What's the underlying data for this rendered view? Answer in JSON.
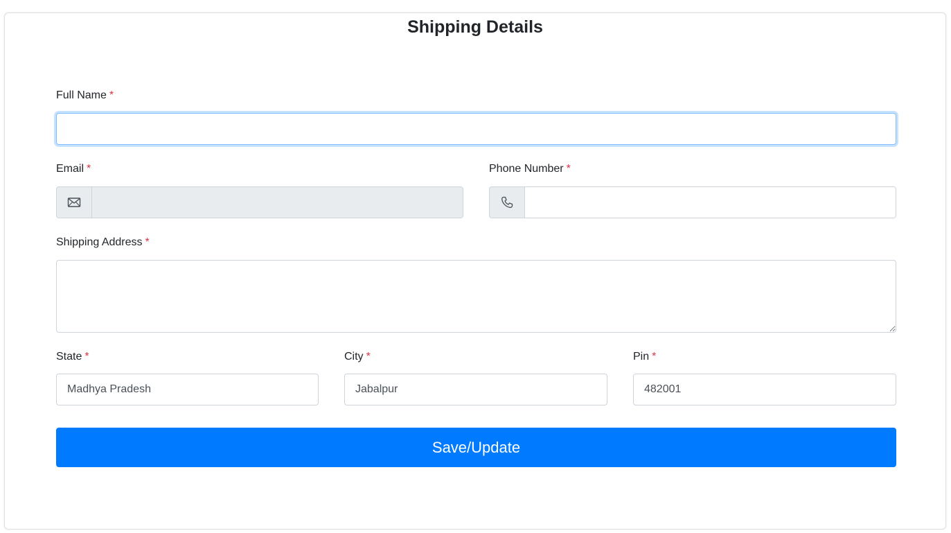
{
  "form": {
    "title": "Shipping Details",
    "required_mark": "*",
    "full_name": {
      "label": "Full Name",
      "value": "",
      "placeholder": ""
    },
    "email": {
      "label": "Email",
      "value": "",
      "icon": "envelope-icon"
    },
    "phone": {
      "label": "Phone Number",
      "value": "",
      "icon": "phone-icon"
    },
    "address": {
      "label": "Shipping Address",
      "value": ""
    },
    "state": {
      "label": "State",
      "value": "Madhya Pradesh"
    },
    "city": {
      "label": "City",
      "value": "Jabalpur"
    },
    "pin": {
      "label": "Pin",
      "value": "482001"
    },
    "submit_label": "Save/Update"
  },
  "colors": {
    "primary": "#007bff",
    "required": "#dc3545",
    "disabled_bg": "#e9ecef",
    "border": "#ced4da"
  }
}
